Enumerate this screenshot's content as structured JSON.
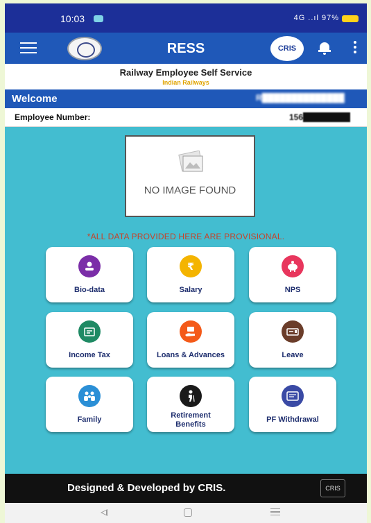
{
  "status_bar": {
    "time": "10:03",
    "signal": "4G ..ıl 97%"
  },
  "app_bar": {
    "title": "RESS",
    "cris_logo": "CRIS",
    "menu_icon": "menu-icon",
    "bell_icon": "bell-icon",
    "more_icon": "more-vert-icon"
  },
  "subheader": {
    "title": "Railway Employee Self Service",
    "subtitle": "Indian Railways"
  },
  "welcome": {
    "label": "Welcome",
    "name": "R██████████████"
  },
  "employee": {
    "label": "Employee Number:",
    "number": "156████████"
  },
  "photo": {
    "placeholder_text": "NO IMAGE FOUND"
  },
  "notice": "*ALL DATA PROVIDED HERE ARE PROVISIONAL.",
  "tiles": [
    {
      "label": "Bio-data",
      "icon": "person-icon",
      "color": "#7b2ea8"
    },
    {
      "label": "Salary",
      "icon": "rupee-icon",
      "color": "#f4b400"
    },
    {
      "label": "NPS",
      "icon": "piggy-bank-icon",
      "color": "#e8365d"
    },
    {
      "label": "Income Tax",
      "icon": "tax-icon",
      "color": "#1f8a64"
    },
    {
      "label": "Loans & Advances",
      "icon": "money-hand-icon",
      "color": "#f45a19"
    },
    {
      "label": "Leave",
      "icon": "calendar-icon",
      "color": "#6b3d2a"
    },
    {
      "label": "Family",
      "icon": "family-icon",
      "color": "#2b8fd6"
    },
    {
      "label": "Retirement Benefits",
      "icon": "elderly-icon",
      "color": "#1a1a1a"
    },
    {
      "label": "PF Withdrawal",
      "icon": "card-icon",
      "color": "#3a4aa5"
    }
  ],
  "footer": {
    "text": "Designed & Developed by CRIS.",
    "logo": "CRIS"
  },
  "colors": {
    "header": "#1c2f98",
    "appbar": "#1f58b8",
    "content": "#43bdd0",
    "footer": "#111111"
  }
}
